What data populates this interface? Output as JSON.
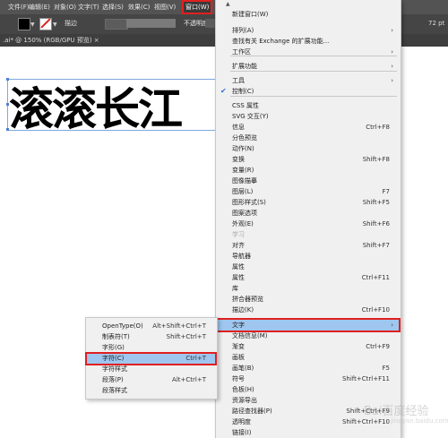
{
  "menubar": {
    "items": [
      "文件(F)",
      "编辑(E)",
      "对象(O)",
      "文字(T)",
      "选择(S)",
      "效果(C)",
      "视图(V)",
      "窗口(W)"
    ]
  },
  "options_bar": {
    "stroke_label": "描边",
    "opacity_label": "不透明度",
    "zoom_value": "72 pt"
  },
  "document_tab": {
    "title": ".ai* @ 150% (RGB/GPU 预览)",
    "close": "×"
  },
  "canvas": {
    "text": "滚滚长江"
  },
  "window_menu": {
    "items": [
      {
        "label": "新建窗口(W)",
        "shortcut": ""
      },
      {
        "label": "排列(A)",
        "submenu": true
      },
      {
        "label": "查找有关 Exchange 的扩展功能...",
        "shortcut": ""
      },
      {
        "label": "工作区",
        "submenu": true
      },
      {
        "label": "扩展功能",
        "submenu": true
      },
      {
        "label": "工具",
        "submenu": true
      },
      {
        "label": "控制(C)",
        "checked": true
      },
      {
        "label": "CSS 属性",
        "shortcut": ""
      },
      {
        "label": "SVG 交互(Y)",
        "shortcut": ""
      },
      {
        "label": "信息",
        "shortcut": "Ctrl+F8"
      },
      {
        "label": "分色预览",
        "shortcut": ""
      },
      {
        "label": "动作(N)",
        "shortcut": ""
      },
      {
        "label": "变换",
        "shortcut": "Shift+F8"
      },
      {
        "label": "变量(R)",
        "shortcut": ""
      },
      {
        "label": "图像描摹",
        "shortcut": ""
      },
      {
        "label": "图层(L)",
        "shortcut": "F7"
      },
      {
        "label": "图形样式(S)",
        "shortcut": "Shift+F5"
      },
      {
        "label": "图案选项",
        "shortcut": ""
      },
      {
        "label": "外观(E)",
        "shortcut": "Shift+F6"
      },
      {
        "label": "学习",
        "shortcut": "",
        "disabled": true
      },
      {
        "label": "对齐",
        "shortcut": "Shift+F7"
      },
      {
        "label": "导航器",
        "shortcut": ""
      },
      {
        "label": "属性",
        "shortcut": ""
      },
      {
        "label": "属性",
        "shortcut": "Ctrl+F11"
      },
      {
        "label": "库",
        "shortcut": ""
      },
      {
        "label": "拼合器预览",
        "shortcut": ""
      },
      {
        "label": "描边(K)",
        "shortcut": "Ctrl+F10"
      },
      {
        "label": "文字",
        "submenu": true,
        "highlighted": true
      },
      {
        "label": "文档信息(M)",
        "shortcut": ""
      },
      {
        "label": "渐变",
        "shortcut": "Ctrl+F9"
      },
      {
        "label": "画板",
        "shortcut": ""
      },
      {
        "label": "画笔(B)",
        "shortcut": "F5"
      },
      {
        "label": "符号",
        "shortcut": "Shift+Ctrl+F11"
      },
      {
        "label": "色板(H)",
        "shortcut": ""
      },
      {
        "label": "资源导出",
        "shortcut": ""
      },
      {
        "label": "路径查找器(P)",
        "shortcut": "Shift+Ctrl+F9"
      },
      {
        "label": "透明度",
        "shortcut": "Shift+Ctrl+F10"
      },
      {
        "label": "链接(I)",
        "shortcut": ""
      }
    ]
  },
  "type_submenu": {
    "items": [
      {
        "label": "OpenType(O)",
        "shortcut": "Alt+Shift+Ctrl+T"
      },
      {
        "label": "制表符(T)",
        "shortcut": "Shift+Ctrl+T"
      },
      {
        "label": "字形(G)",
        "shortcut": ""
      },
      {
        "label": "字符(C)",
        "shortcut": "Ctrl+T",
        "highlighted": true
      },
      {
        "label": "字符样式",
        "shortcut": ""
      },
      {
        "label": "段落(P)",
        "shortcut": "Alt+Ctrl+T"
      },
      {
        "label": "段落样式",
        "shortcut": ""
      }
    ]
  },
  "watermark": {
    "text": "Bai百度经验",
    "sub": "jingyan.baidu.com"
  },
  "colors": {
    "menubar": "#535353",
    "menu_bg": "#f0f0f0",
    "highlight": "#9ec6ee",
    "annotation_red": "#e02020",
    "selection_blue": "#4f7fd0"
  }
}
